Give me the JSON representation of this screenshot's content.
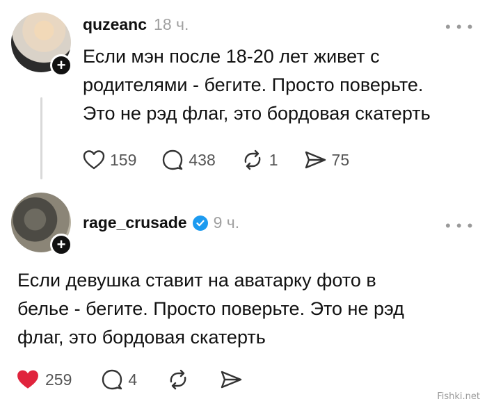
{
  "posts": [
    {
      "username": "quzeanc",
      "time": "18 ч.",
      "text_lines": [
        "Если мэн после 18-20 лет живет с",
        "родителями -  бегите. Просто поверьте.",
        "Это не рэд флаг, это бордовая скатерть"
      ],
      "likes": "159",
      "comments": "438",
      "reposts": "1",
      "shares": "75"
    },
    {
      "username": "rage_crusade",
      "time": "9 ч.",
      "text_lines": [
        "Если девушка ставит на аватарку фото в",
        "белье -  бегите. Просто поверьте. Это не рэд",
        "флаг, это бордовая скатерть"
      ],
      "likes": "259",
      "comments": "4"
    }
  ],
  "ui": {
    "more": "• • •",
    "follow": "+"
  },
  "watermark": "Fishki.net",
  "colors": {
    "liked_heart": "#e0243d",
    "verified": "#1d9bf0",
    "muted": "#a0a0a0"
  }
}
